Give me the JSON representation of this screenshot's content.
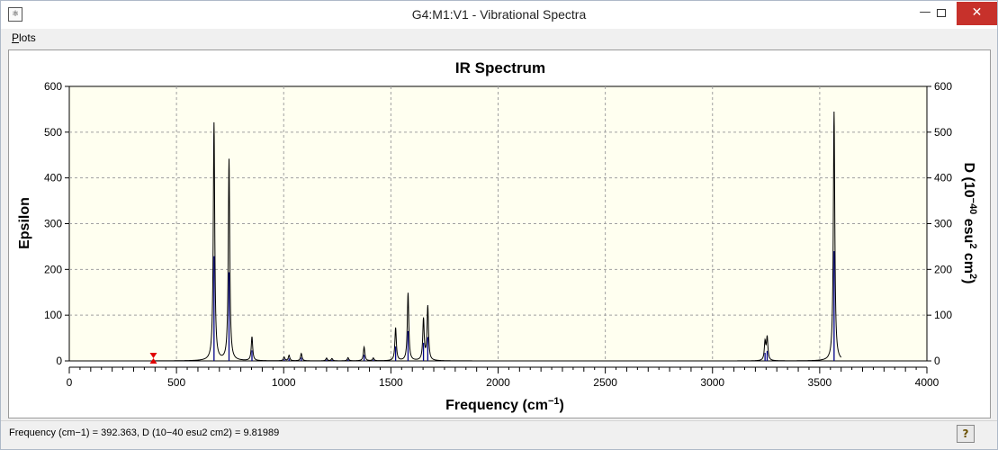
{
  "window": {
    "title": "G4:M1:V1 - Vibrational Spectra",
    "app_icon_glyph": "⚛",
    "min_glyph": "—",
    "close_glyph": "✕"
  },
  "menu": {
    "plots_first": "P",
    "plots_rest": "lots"
  },
  "chart_data": {
    "type": "line",
    "title": "IR Spectrum",
    "xlabel": "Frequency (cm",
    "xlabel_sup": "−1",
    "xlabel_end": ")",
    "ylabel": "Epsilon",
    "y2label": "D (10",
    "y2label_sup1": "−40",
    "y2label_mid": " esu",
    "y2label_sup2": "2",
    "y2label_mid2": " cm",
    "y2label_sup3": "2",
    "y2label_end": ")",
    "xlim": [
      0,
      4000
    ],
    "ylim": [
      0,
      600
    ],
    "y2lim": [
      0,
      600
    ],
    "x_ticks": [
      0,
      500,
      1000,
      1500,
      2000,
      2500,
      3000,
      3500,
      4000
    ],
    "y_ticks": [
      0,
      100,
      200,
      300,
      400,
      500,
      600
    ],
    "y2_ticks": [
      0,
      100,
      200,
      300,
      400,
      500,
      600
    ],
    "grid": true,
    "line_color": "#000000",
    "stick_color": "#00008b",
    "marker_color": "#e00000",
    "cursor_x": 392.363,
    "spectrum_range": [
      400,
      3600
    ],
    "peaks": [
      {
        "x": 675,
        "y": 520
      },
      {
        "x": 745,
        "y": 440
      },
      {
        "x": 852,
        "y": 52
      },
      {
        "x": 1002,
        "y": 8
      },
      {
        "x": 1025,
        "y": 12
      },
      {
        "x": 1082,
        "y": 16
      },
      {
        "x": 1200,
        "y": 6
      },
      {
        "x": 1225,
        "y": 5
      },
      {
        "x": 1300,
        "y": 7
      },
      {
        "x": 1375,
        "y": 30
      },
      {
        "x": 1418,
        "y": 6
      },
      {
        "x": 1522,
        "y": 72
      },
      {
        "x": 1580,
        "y": 148
      },
      {
        "x": 1652,
        "y": 90
      },
      {
        "x": 1672,
        "y": 118
      },
      {
        "x": 3245,
        "y": 40
      },
      {
        "x": 3255,
        "y": 50
      },
      {
        "x": 3567,
        "y": 545
      }
    ]
  },
  "status": {
    "text": "Frequency (cm−1) = 392.363, D (10−40 esu2 cm2) = 9.81989",
    "help_glyph": "?"
  }
}
